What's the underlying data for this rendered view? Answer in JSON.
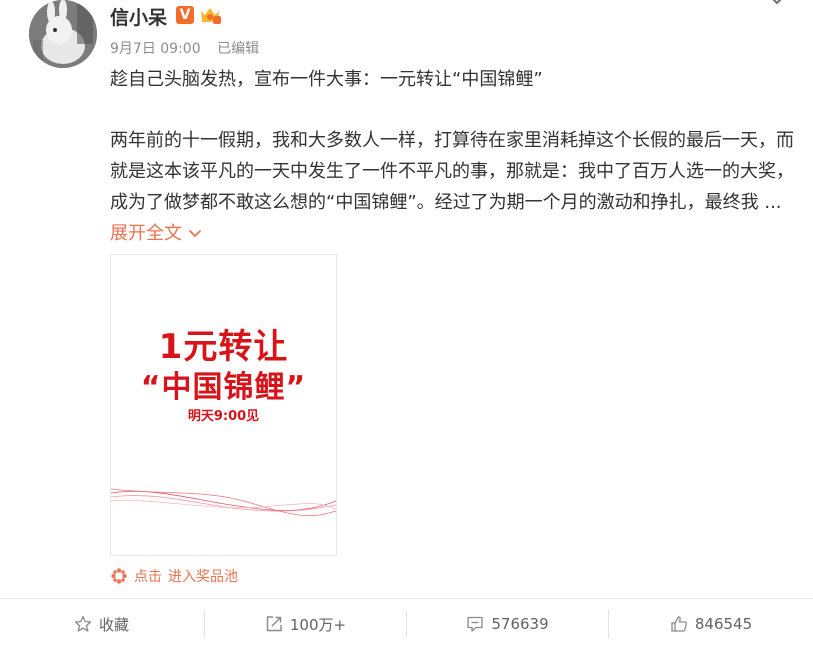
{
  "user": {
    "name": "信小呆",
    "verified_badge": "V",
    "date": "9月7日 09:00",
    "edited": "已编辑",
    "colors": {
      "verified": "#f56b2b"
    }
  },
  "post": {
    "headline": "趁自己头脑发热，宣布一件大事：一元转让“中国锦鲤”",
    "body_part1": "两年前的十一假期，我和大多数人一样，打算待在家里消耗掉这个长假的最后一天，而就是这本该平凡的一天中发生了一件不平凡的事，那就是：我中了百万人选一的大奖，成为了做梦都不敢这么想的“中国锦鲤”。经过了为期一个月的激动和挣扎，最终我 ...",
    "expand_label": "展开全文"
  },
  "image_card": {
    "line1": "1元转让",
    "line2": "“中国锦鲤”",
    "line3": "明天9:00见",
    "color": "#d7141a"
  },
  "lottery": {
    "click_label": "点击",
    "pool_label": "进入奖品池",
    "color": "#eb7350"
  },
  "actions": {
    "favorite": "收藏",
    "repost": "100万+",
    "comment": "576639",
    "like": "846545"
  }
}
